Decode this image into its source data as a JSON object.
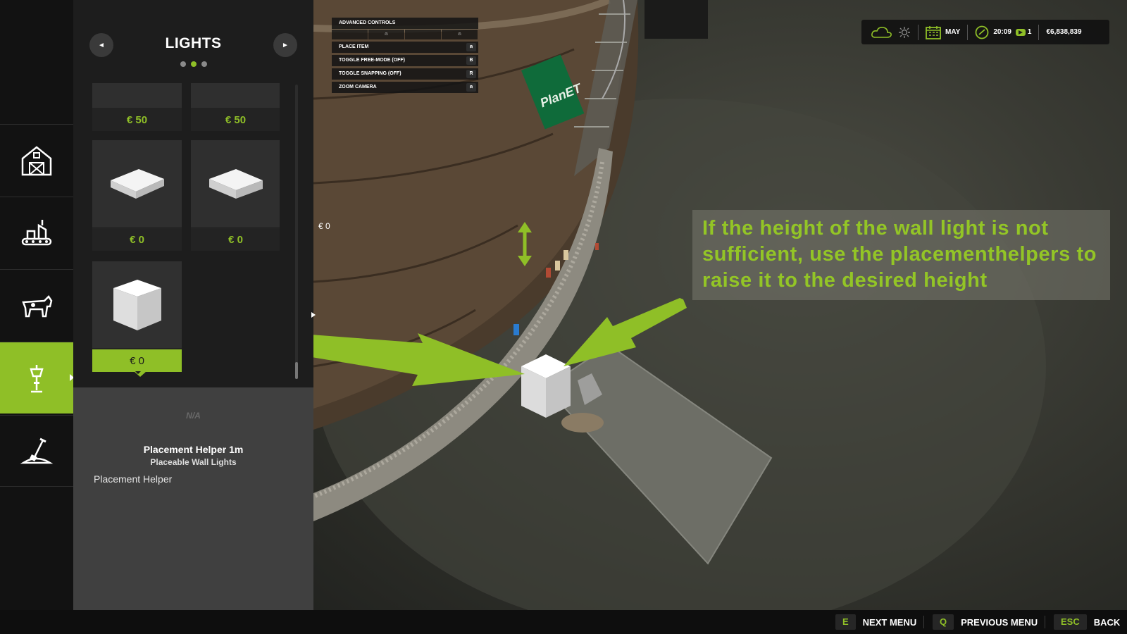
{
  "shop": {
    "title": "LIGHTS",
    "prev_label": "◄",
    "next_label": "►",
    "tiles": [
      {
        "price": "€ 50"
      },
      {
        "price": "€ 50"
      },
      {
        "price": "€ 0"
      },
      {
        "price": "€ 0"
      },
      {
        "price": "€ 0"
      }
    ]
  },
  "info": {
    "na": "N/A",
    "name": "Placement Helper 1m",
    "category": "Placeable Wall Lights",
    "description": "Placement Helper"
  },
  "controls": {
    "title": "ADVANCED CONTROLS",
    "rows": [
      {
        "label": "PLACE ITEM",
        "key": "⍝"
      },
      {
        "label": "TOGGLE FREE-MODE (OFF)",
        "key": "B"
      },
      {
        "label": "TOGGLE SNAPPING (OFF)",
        "key": "R"
      },
      {
        "label": "ZOOM CAMERA",
        "key": "⍝"
      }
    ]
  },
  "cursor_price": "€ 0",
  "hud": {
    "month": "MAY",
    "time": "20:09",
    "speed": "1",
    "money": "€6,838,839"
  },
  "sign_text": "PlanET",
  "note": "If the height of the wall light is not sufficient, use the placementhelpers to raise it to the desired height",
  "bottom": {
    "hints": [
      {
        "key": "E",
        "label": "NEXT MENU"
      },
      {
        "key": "Q",
        "label": "PREVIOUS MENU"
      },
      {
        "key": "ESC",
        "label": "BACK"
      }
    ]
  },
  "colors": {
    "accent": "#8fbf27",
    "note_text": "#93c526",
    "panel": "#1d1d1d",
    "info_panel": "#404040"
  }
}
